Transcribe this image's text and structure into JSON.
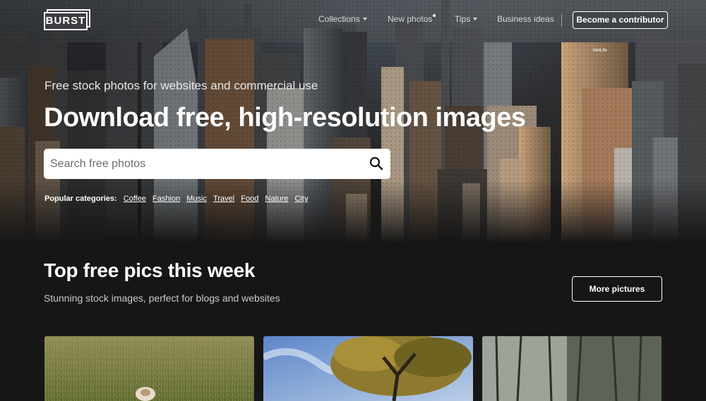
{
  "header": {
    "logo_text": "BURST",
    "nav": [
      {
        "label": "Collections",
        "has_dropdown": true
      },
      {
        "label": "New photos",
        "has_dropdown": false
      },
      {
        "label": "Tips",
        "has_dropdown": true
      },
      {
        "label": "Business ideas",
        "has_dropdown": false
      }
    ],
    "cta_label": "Become a contributor"
  },
  "hero": {
    "tagline": "Free stock photos for websites and commercial use",
    "headline": "Download free, high-resolution images",
    "search_placeholder": "Search free photos",
    "categories_label": "Popular categories:",
    "categories": [
      "Coffee",
      "Fashion",
      "Music",
      "Travel",
      "Food",
      "Nature",
      "City"
    ]
  },
  "section": {
    "title": "Top free pics this week",
    "subtitle": "Stunning stock images, perfect for blogs and websites",
    "more_label": "More pictures"
  },
  "icons": {
    "search": "search-icon",
    "caret": "chevron-down-icon"
  },
  "colors": {
    "background": "#161616",
    "text": "#ffffff",
    "search_bg": "#ffffff"
  }
}
